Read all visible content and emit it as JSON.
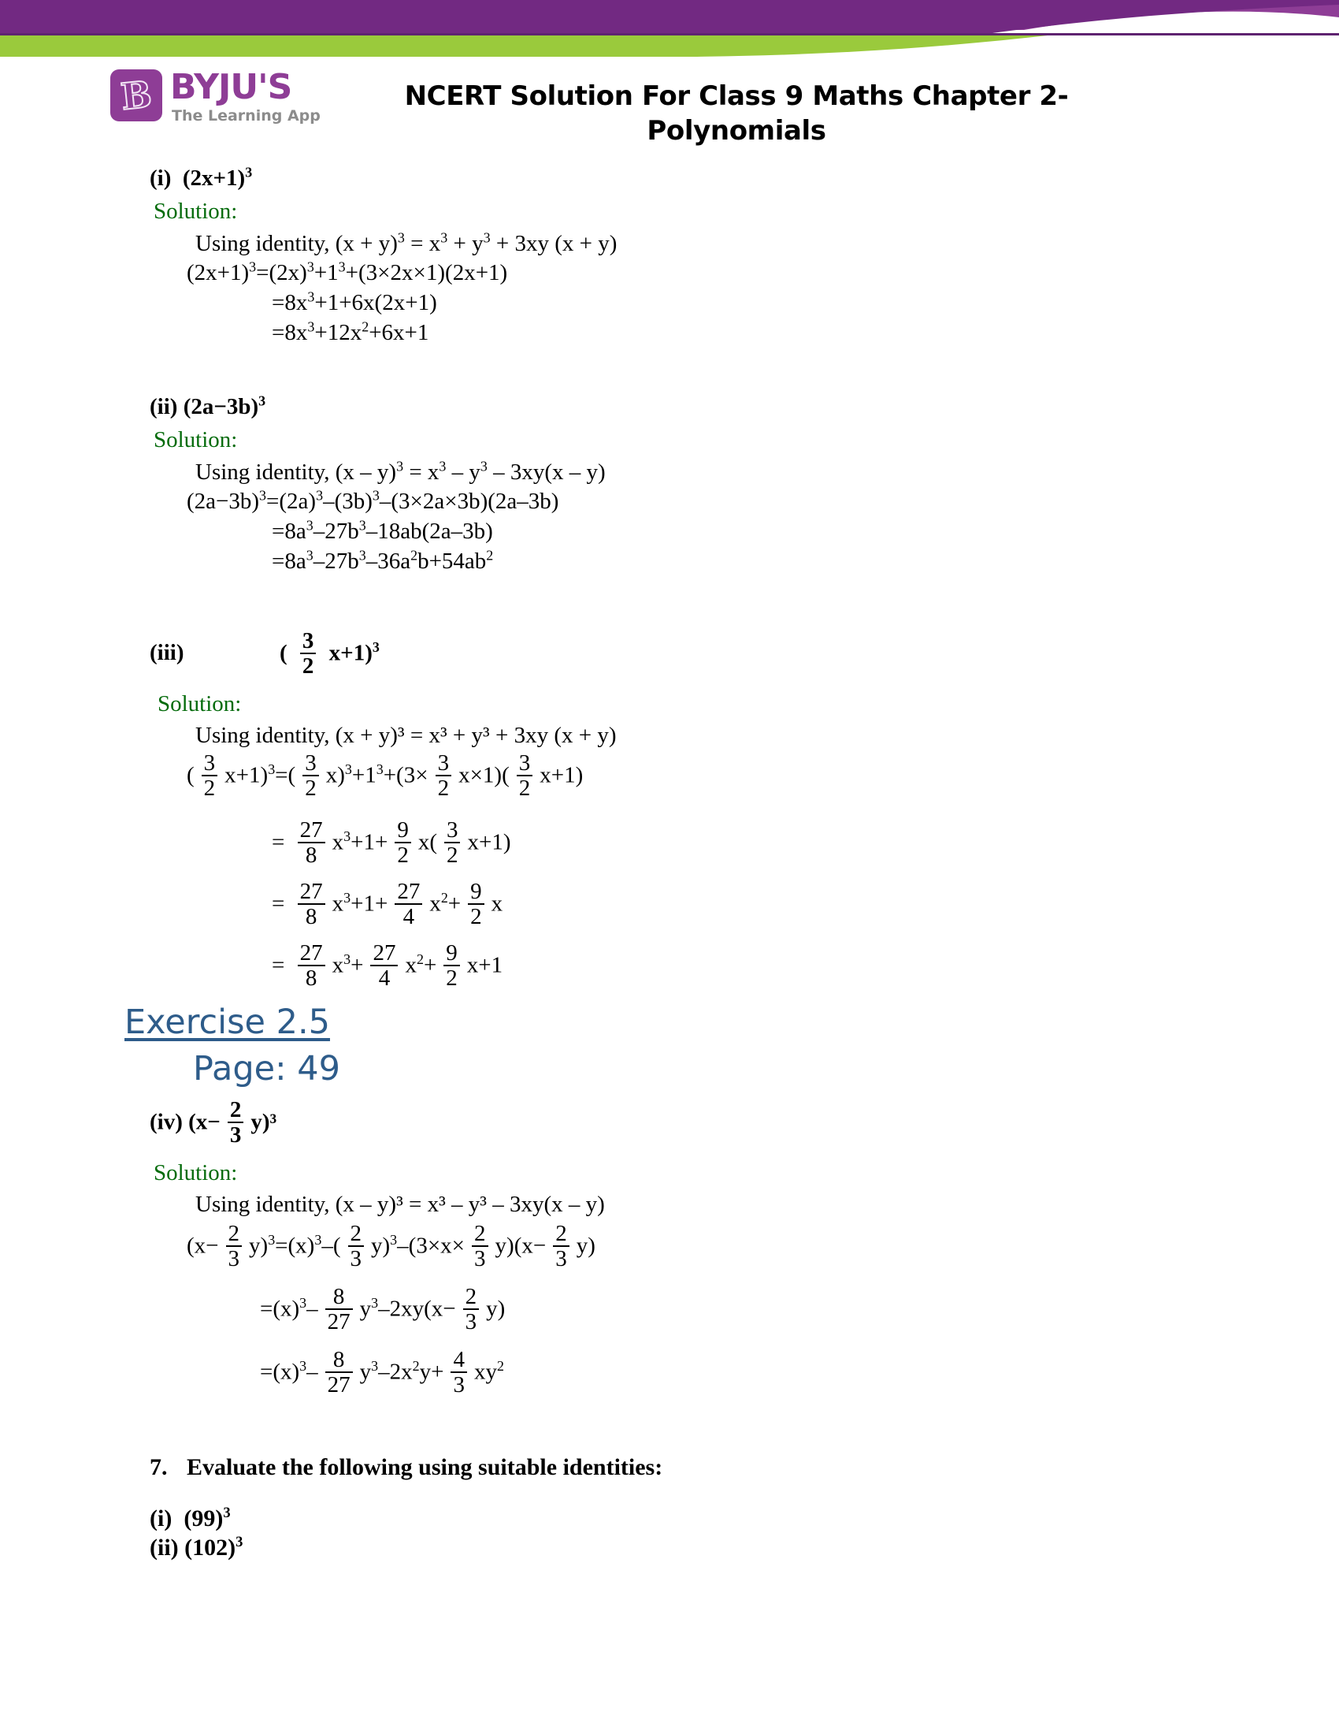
{
  "header": {
    "title": "NCERT Solution For Class 9 Maths Chapter 2-\nPolynomials",
    "title_line1": "NCERT Solution For Class 9 Maths Chapter 2-",
    "title_line2": "Polynomials",
    "logo": {
      "mark_letter": "B",
      "wordmark": "BYJU'S",
      "tagline": "The Learning App"
    },
    "colors": {
      "purple": "#722982",
      "purple_light": "#8E3D96",
      "green": "#9ACA3C",
      "title_color": "#000000"
    }
  },
  "labels": {
    "solution": "Solution:"
  },
  "colors": {
    "solution_green": "#046B0B",
    "heading_blue": "#2E5C8A",
    "body_black": "#000000"
  },
  "sections": [
    {
      "id": "part-i",
      "label_prefix": "(i)",
      "expression_plain": "(2x+1)³",
      "solution_label": "Solution:",
      "lines": [
        "Using identity, (x + y)³ = x³ + y³ + 3xy (x + y)",
        "(2x+1)³=(2x)³+1³+(3×2x×1)(2x+1)",
        "=8x³+1+6x(2x+1)",
        "=8x³+12x²+6x+1"
      ]
    },
    {
      "id": "part-ii",
      "label_prefix": "(ii)",
      "expression_plain": "(2a−3b)³",
      "solution_label": "Solution:",
      "lines": [
        "Using identity, (x – y)³ = x³ – y³ – 3xy(x – y)",
        "(2a−3b)³=(2a)³–(3b)³–(3×2a×3b)(2a–3b)",
        "=8a³–27b³–18ab(2a–3b)",
        "=8a³–27b³–36a²b+54ab²"
      ]
    },
    {
      "id": "part-iii",
      "label_prefix": "(iii)",
      "expression_plain": "( 3/2 x+1)³",
      "solution_label": "Solution:",
      "identity": "Using identity, (x + y)³ = x³ + y³ + 3xy (x + y)",
      "fractions": {
        "three_halves_num": "3",
        "three_halves_den": "2",
        "twentyseven_eighths_num": "27",
        "twentyseven_eighths_den": "8",
        "nine_halves_num": "9",
        "nine_halves_den": "2",
        "twentyseven_fourths_num": "27",
        "twentyseven_fourths_den": "4"
      },
      "line_fragments": {
        "l1_a": "(",
        "l1_b": "x+1)³=(",
        "l1_c": "x)³+1³+(3×",
        "l1_d": "x×1)(",
        "l1_e": "x+1)",
        "l2_eq": "=",
        "l2_a": "x³+1+",
        "l2_b": "x(",
        "l2_c": "x+1)",
        "l3_eq": "=",
        "l3_a": "x³+1+",
        "l3_b": "x²+",
        "l3_c": "x",
        "l4_eq": "=",
        "l4_a": "x³+",
        "l4_b": "x²+",
        "l4_c": "x+1"
      }
    },
    {
      "id": "part-iv",
      "label_prefix": "(iv)",
      "expression_plain": "(x− 2/3 y)³",
      "solution_label": "Solution:",
      "identity": "Using identity, (x – y)³ = x³ – y³ – 3xy(x – y)",
      "fractions": {
        "two_thirds_num": "2",
        "two_thirds_den": "3",
        "eight_twentysevenths_num": "8",
        "eight_twentysevenths_den": "27",
        "four_thirds_num": "4",
        "four_thirds_den": "3"
      },
      "line_fragments": {
        "head_a": "(iv) (x−",
        "head_b": "y)³",
        "l1_a": "(x−",
        "l1_b": "y)³=(x)³–(",
        "l1_c": "y)³–(3×x×",
        "l1_d": "y)(x−",
        "l1_e": "y)",
        "l2_a": "=(x)³–",
        "l2_b": "y³–2xy(x−",
        "l2_c": "y)",
        "l3_a": "=(x)³–",
        "l3_b": "y³–2x²y+",
        "l3_c": "xy²"
      }
    }
  ],
  "exercise_heading": {
    "title": "Exercise 2.5",
    "page": "Page: 49"
  },
  "question7": {
    "number": "7.",
    "text": "Evaluate the following using suitable identities:",
    "items": [
      {
        "label": "(i)",
        "expr_base": "(99)",
        "expr_exp": "3"
      },
      {
        "label": "(ii)",
        "expr_base": "(102)",
        "expr_exp": "3"
      }
    ]
  }
}
